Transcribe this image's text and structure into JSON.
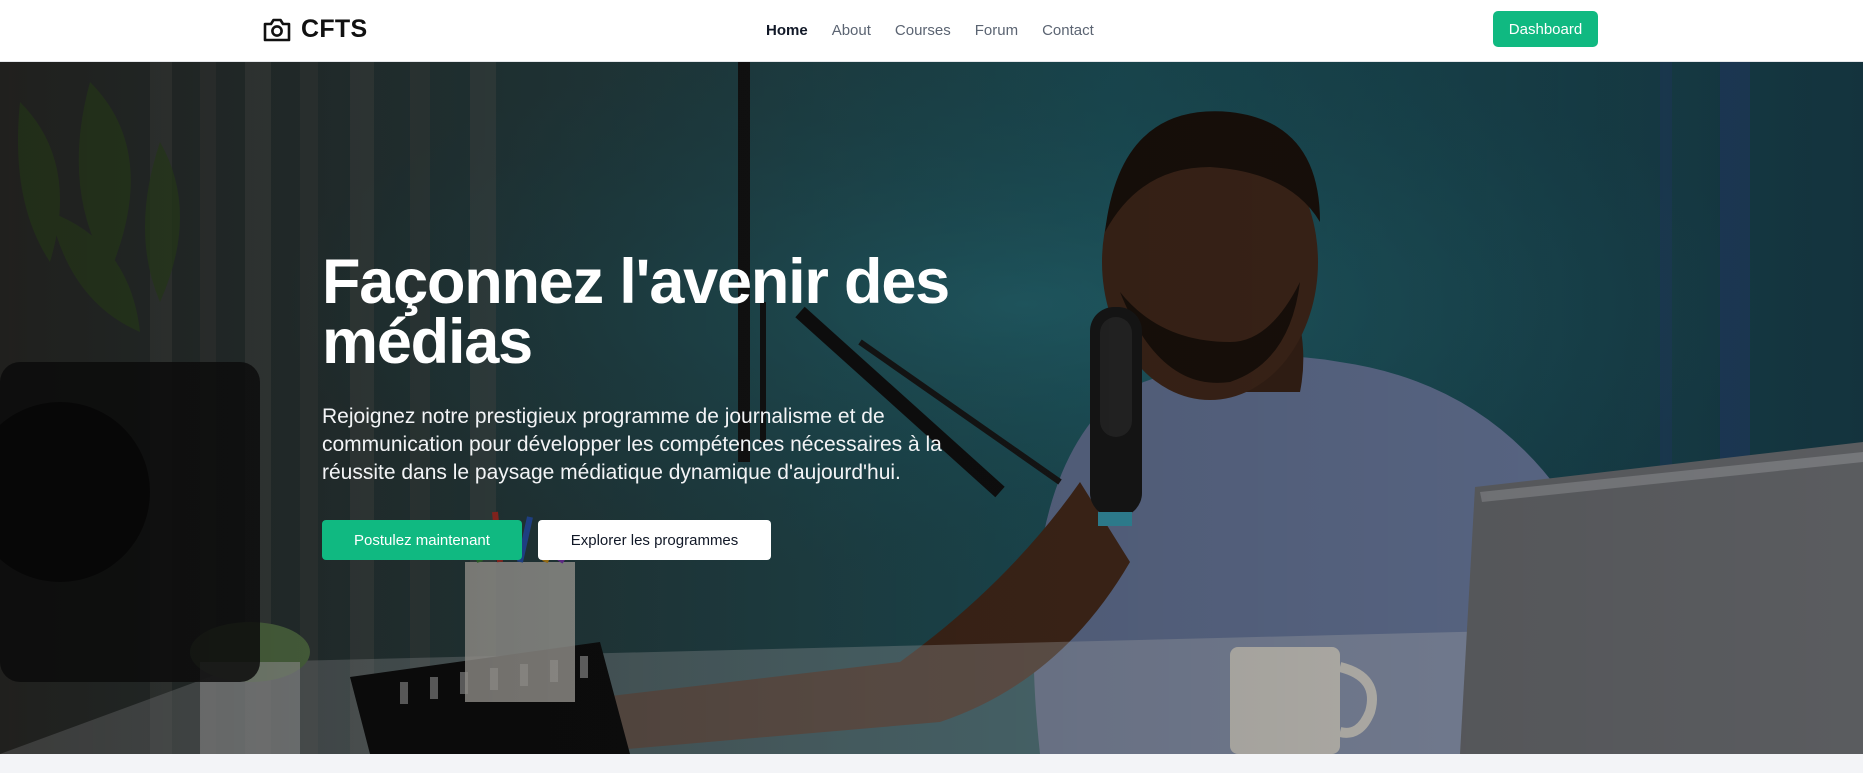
{
  "brand": {
    "name": "CFTS",
    "icon": "camera-icon"
  },
  "nav": {
    "links": [
      {
        "label": "Home",
        "active": true
      },
      {
        "label": "About",
        "active": false
      },
      {
        "label": "Courses",
        "active": false
      },
      {
        "label": "Forum",
        "active": false
      },
      {
        "label": "Contact",
        "active": false
      }
    ],
    "dashboard_label": "Dashboard"
  },
  "hero": {
    "title": "Façonnez l'avenir des médias",
    "subtitle": "Rejoignez notre prestigieux programme de journalisme et de communication pour développer les compétences nécessaires à la réussite dans le paysage médiatique dynamique d'aujourd'hui.",
    "primary_cta": "Postulez maintenant",
    "secondary_cta": "Explorer les programmes"
  },
  "colors": {
    "accent": "#10b981",
    "nav_text": "#5b6472",
    "nav_active": "#111827",
    "hero_backdrop": "#1f5963"
  }
}
